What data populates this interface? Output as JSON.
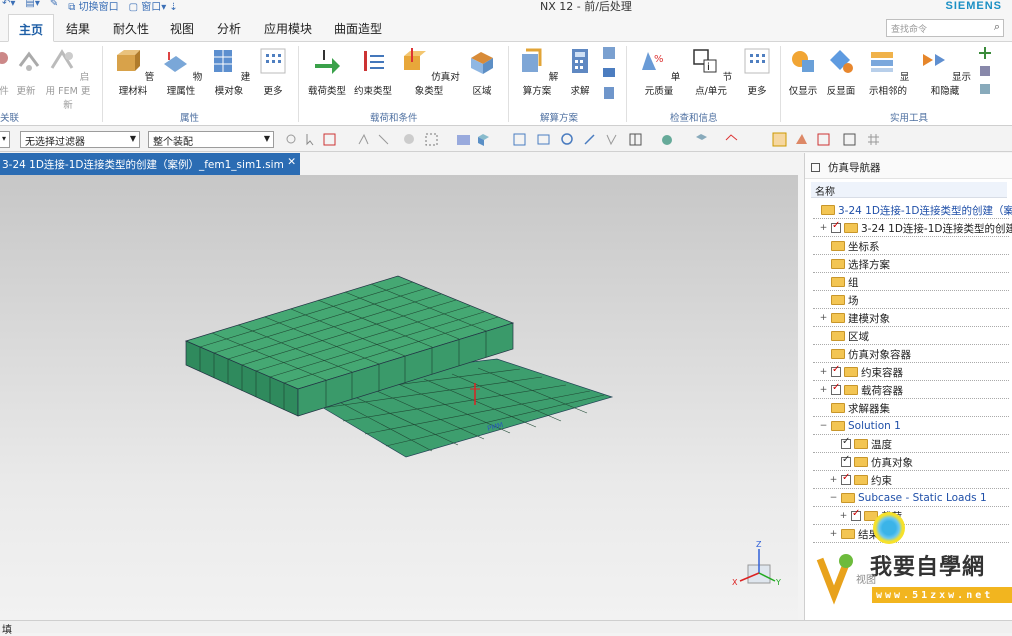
{
  "app": {
    "title": "NX 12 - 前/后处理",
    "brand": "SIEMENS"
  },
  "quick_access": {
    "switch_window": "切换窗口",
    "window": "窗口"
  },
  "menu": {
    "tabs": [
      "主页",
      "结果",
      "耐久性",
      "视图",
      "分析",
      "应用模块",
      "曲面造型"
    ],
    "active_tab": "主页",
    "search_placeholder": "查找命令"
  },
  "ribbon": {
    "groups": [
      {
        "label": "关联",
        "buttons": [
          "件",
          "更新",
          "启用 FEM 更新"
        ]
      },
      {
        "label": "属性",
        "buttons": [
          "管理材料",
          "物理属性",
          "建模对象",
          "更多"
        ]
      },
      {
        "label": "载荷和条件",
        "buttons": [
          "载荷类型",
          "约束类型",
          "仿真对象类型",
          "区域"
        ]
      },
      {
        "label": "解算方案",
        "buttons": [
          "解算方案",
          "求解"
        ]
      },
      {
        "label": "检查和信息",
        "buttons": [
          "单元质量",
          "节点/单元",
          "更多"
        ]
      },
      {
        "label": "实用工具",
        "buttons": [
          "仅显示",
          "反显面",
          "显示相邻的",
          "显示和隐藏"
        ]
      }
    ]
  },
  "filterbar": {
    "filter": "无选择过滤器",
    "scope": "整个装配"
  },
  "document": {
    "tab_label": "3-24 1D连接-1D连接类型的创建（案例）_fem1_sim1.sim"
  },
  "navigator": {
    "title": "仿真导航器",
    "column": "名称",
    "rows": [
      {
        "indent": 0,
        "text": "3-24 1D连接-1D连接类型的创建（案例",
        "expander": "",
        "check": "",
        "blue": true
      },
      {
        "indent": 1,
        "text": "3-24 1D连接-1D连接类型的创建",
        "expander": "+",
        "check": "on",
        "blue": false
      },
      {
        "indent": 1,
        "text": "坐标系",
        "expander": "",
        "check": "",
        "blue": false
      },
      {
        "indent": 1,
        "text": "选择方案",
        "expander": "",
        "check": "",
        "blue": false
      },
      {
        "indent": 1,
        "text": "组",
        "expander": "",
        "check": "",
        "blue": false
      },
      {
        "indent": 1,
        "text": "场",
        "expander": "",
        "check": "",
        "blue": false
      },
      {
        "indent": 1,
        "text": "建模对象",
        "expander": "+",
        "check": "",
        "blue": false
      },
      {
        "indent": 1,
        "text": "区域",
        "expander": "",
        "check": "",
        "blue": false
      },
      {
        "indent": 1,
        "text": "仿真对象容器",
        "expander": "",
        "check": "",
        "blue": false
      },
      {
        "indent": 1,
        "text": "约束容器",
        "expander": "+",
        "check": "on",
        "blue": false
      },
      {
        "indent": 1,
        "text": "载荷容器",
        "expander": "+",
        "check": "on",
        "blue": false
      },
      {
        "indent": 1,
        "text": "求解器集",
        "expander": "",
        "check": "",
        "blue": false
      },
      {
        "indent": 1,
        "text": "Solution 1",
        "expander": "−",
        "check": "",
        "blue": true
      },
      {
        "indent": 2,
        "text": "温度",
        "expander": "",
        "check": "on2",
        "blue": false
      },
      {
        "indent": 2,
        "text": "仿真对象",
        "expander": "",
        "check": "on2",
        "blue": false
      },
      {
        "indent": 2,
        "text": "约束",
        "expander": "+",
        "check": "on",
        "blue": false
      },
      {
        "indent": 2,
        "text": "Subcase - Static Loads 1",
        "expander": "−",
        "check": "",
        "blue": true
      },
      {
        "indent": 3,
        "text": "载荷",
        "expander": "+",
        "check": "on",
        "blue": false
      },
      {
        "indent": 2,
        "text": "结果",
        "expander": "+",
        "check": "",
        "blue": false
      }
    ]
  },
  "watermark": {
    "text": "我要自學網",
    "url": "www.51zxw.net",
    "overlay": "视图"
  },
  "status": {
    "text": "填"
  },
  "colors": {
    "accent": "#2b6cb3",
    "mesh": "#3d9e6e",
    "brand": "#1a8fc4"
  }
}
